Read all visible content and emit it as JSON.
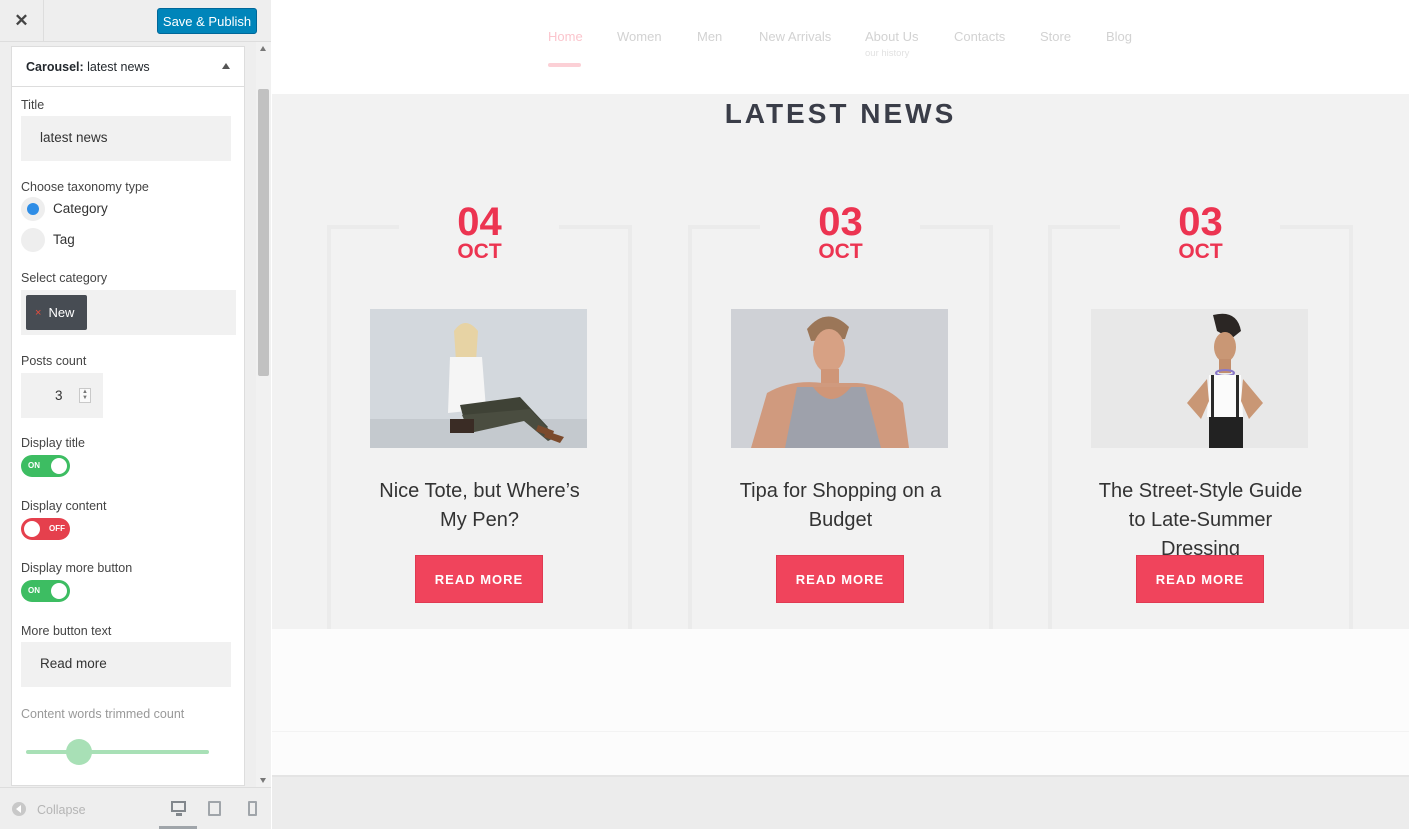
{
  "topbar": {
    "close_symbol": "✕",
    "publish_label": "Save & Publish"
  },
  "panel": {
    "section_type": "Carousel:",
    "section_name": "latest news",
    "title_label": "Title",
    "title_value": "latest news",
    "taxonomy_label": "Choose taxonomy type",
    "taxonomy_options": [
      "Category",
      "Tag"
    ],
    "taxonomy_selected": "Category",
    "category_label": "Select category",
    "category_tag": "New",
    "category_remove": "×",
    "posts_count_label": "Posts count",
    "posts_count_value": "3",
    "display_title_label": "Display title",
    "display_title_state": "ON",
    "display_content_label": "Display content",
    "display_content_state": "OFF",
    "display_more_label": "Display more button",
    "display_more_state": "ON",
    "more_text_label": "More button text",
    "more_text_value": "Read more",
    "trim_label": "Content words trimmed count"
  },
  "footer": {
    "collapse_label": "Collapse",
    "active_device": "desktop"
  },
  "nav": {
    "items": [
      "Home",
      "Women",
      "Men",
      "New Arrivals",
      "About Us",
      "Contacts",
      "Store",
      "Blog"
    ],
    "active": "Home",
    "about_sub": "our history"
  },
  "news": {
    "heading": "LATEST NEWS",
    "posts": [
      {
        "day": "04",
        "month": "OCT",
        "title": "Nice Tote, but Where’s My Pen?",
        "button": "READ MORE"
      },
      {
        "day": "03",
        "month": "OCT",
        "title": "Tipa for Shopping on a Budget",
        "button": "READ MORE"
      },
      {
        "day": "03",
        "month": "OCT",
        "title": "The Street-Style Guide to Late-Summer Dressing",
        "button": "READ MORE"
      }
    ]
  },
  "colors": {
    "accent": "#ec3451",
    "button": "#f0445c",
    "publish": "#0085ba",
    "toggle_on": "#3dbd62",
    "toggle_off": "#e5404d",
    "radio": "#2e8de6"
  }
}
